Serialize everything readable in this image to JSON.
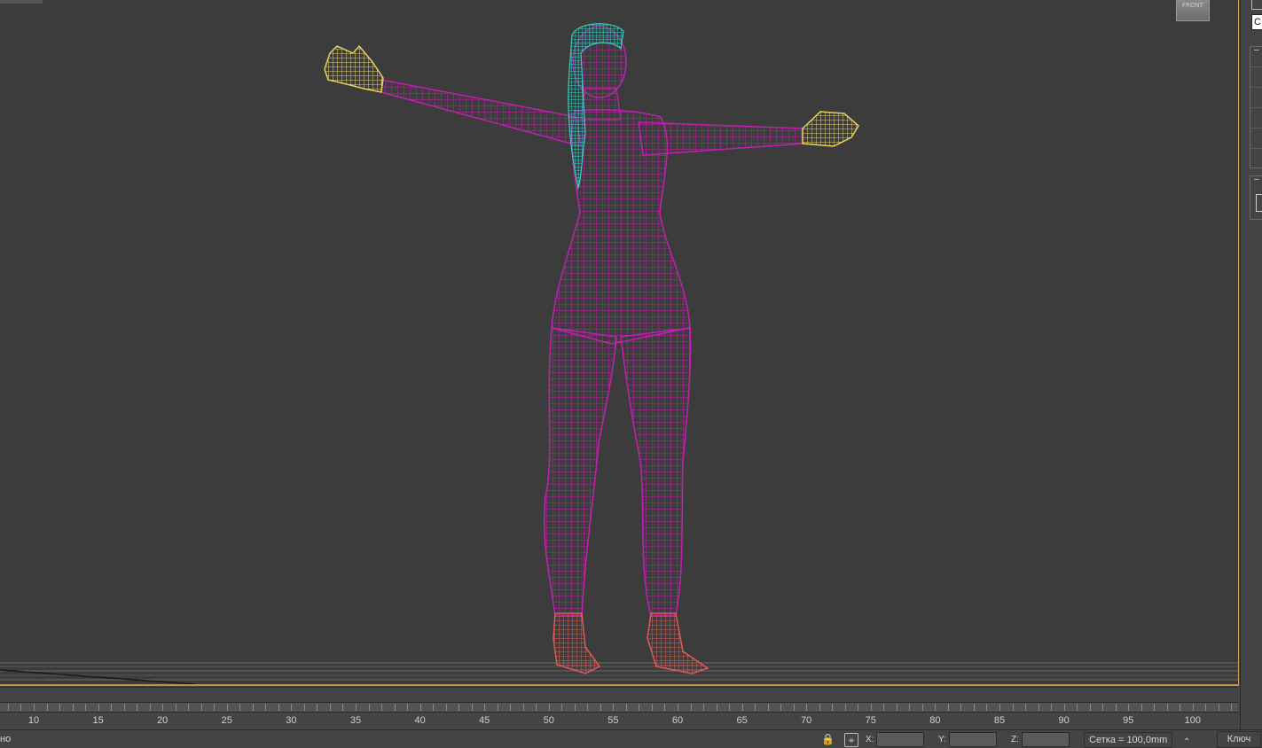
{
  "viewport": {
    "label": "FRONT",
    "model_name": "female-body-wireframe",
    "colors": {
      "body": "#c21fb0",
      "hands": "#e7cf62",
      "feet": "#e25a52",
      "hair": "#3fd9c7",
      "background": "#3c3c3c",
      "border_active": "#c8a24a"
    }
  },
  "command_panel": {
    "dropdown_value": "С"
  },
  "timeline": {
    "ticks": [
      "10",
      "15",
      "20",
      "25",
      "30",
      "35",
      "40",
      "45",
      "50",
      "55",
      "60",
      "65",
      "70",
      "75",
      "80",
      "85",
      "90",
      "95",
      "100"
    ]
  },
  "statusbar": {
    "prompt_fragment": "но",
    "x_label": "X:",
    "y_label": "Y:",
    "z_label": "Z:",
    "x_value": "",
    "y_value": "",
    "z_value": "",
    "grid_text": "Сетка = 100,0mm",
    "key_button": "Ключ"
  }
}
